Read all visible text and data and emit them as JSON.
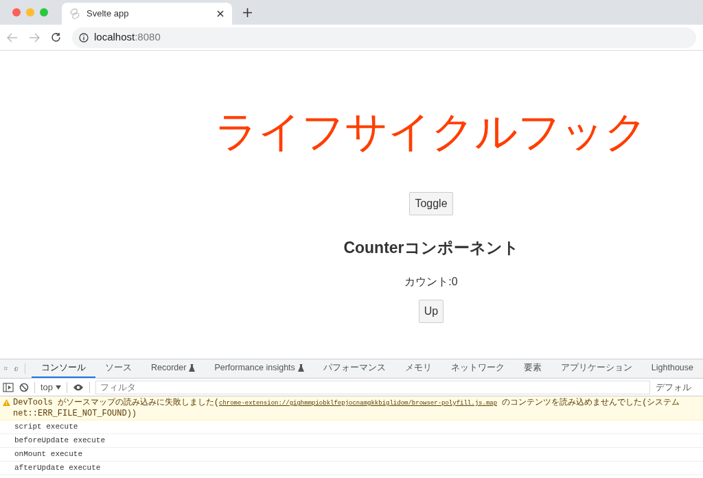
{
  "browser": {
    "tab_title": "Svelte app",
    "address": "localhost",
    "port": ":8080"
  },
  "page": {
    "title": "ライフサイクルフック",
    "toggle_button": "Toggle",
    "heading": "Counterコンポーネント",
    "count_label": "カウント:0",
    "up_button": "Up"
  },
  "devtools": {
    "tabs": [
      {
        "label": "コンソール",
        "selected": true,
        "experimental": false
      },
      {
        "label": "ソース",
        "selected": false,
        "experimental": false
      },
      {
        "label": "Recorder",
        "selected": false,
        "experimental": true
      },
      {
        "label": "Performance insights",
        "selected": false,
        "experimental": true
      },
      {
        "label": "パフォーマンス",
        "selected": false,
        "experimental": false
      },
      {
        "label": "メモリ",
        "selected": false,
        "experimental": false
      },
      {
        "label": "ネットワーク",
        "selected": false,
        "experimental": false
      },
      {
        "label": "要素",
        "selected": false,
        "experimental": false
      },
      {
        "label": "アプリケーション",
        "selected": false,
        "experimental": false
      },
      {
        "label": "Lighthouse",
        "selected": false,
        "experimental": false
      }
    ],
    "context": "top",
    "filter_placeholder": "フィルタ",
    "levels": "デフォル",
    "messages": [
      {
        "kind": "warning",
        "prefix": "DevTools がソースマップの読み込みに失敗しました(",
        "link": "chrome-extension://gighmmpiobklfepjocnamgkkbiglidom/browser-polyfill.js.map",
        "suffix": " のコンテンツを読み込めませんでした(システム",
        "continuation": "net::ERR_FILE_NOT_FOUND))"
      },
      {
        "kind": "log",
        "text": "script execute"
      },
      {
        "kind": "log",
        "text": "beforeUpdate execute"
      },
      {
        "kind": "log",
        "text": "onMount execute"
      },
      {
        "kind": "log",
        "text": "afterUpdate execute"
      }
    ]
  }
}
